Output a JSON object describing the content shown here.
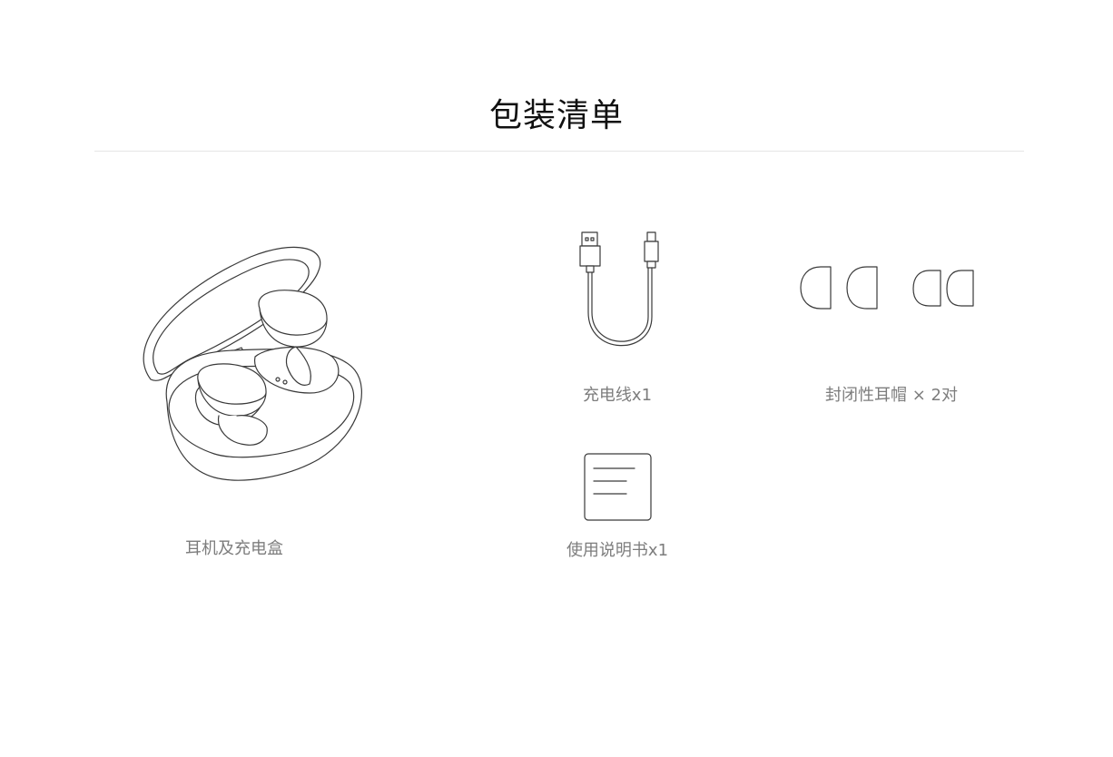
{
  "page": {
    "title": "包装清单"
  },
  "items": [
    {
      "id": "earbuds-case",
      "label": "耳机及充电盒",
      "icon": "earbuds-case-icon"
    },
    {
      "id": "charging-cable",
      "label": "充电线x1",
      "icon": "usb-cable-icon"
    },
    {
      "id": "ear-tips",
      "label": "封闭性耳帽 × 2对",
      "icon": "ear-tips-icon"
    },
    {
      "id": "manual",
      "label": "使用说明书x1",
      "icon": "manual-icon"
    }
  ],
  "colors": {
    "title": "#111111",
    "caption": "#7d7d7d",
    "divider": "#e6e6e6",
    "line_art": "#3a3a3a"
  }
}
